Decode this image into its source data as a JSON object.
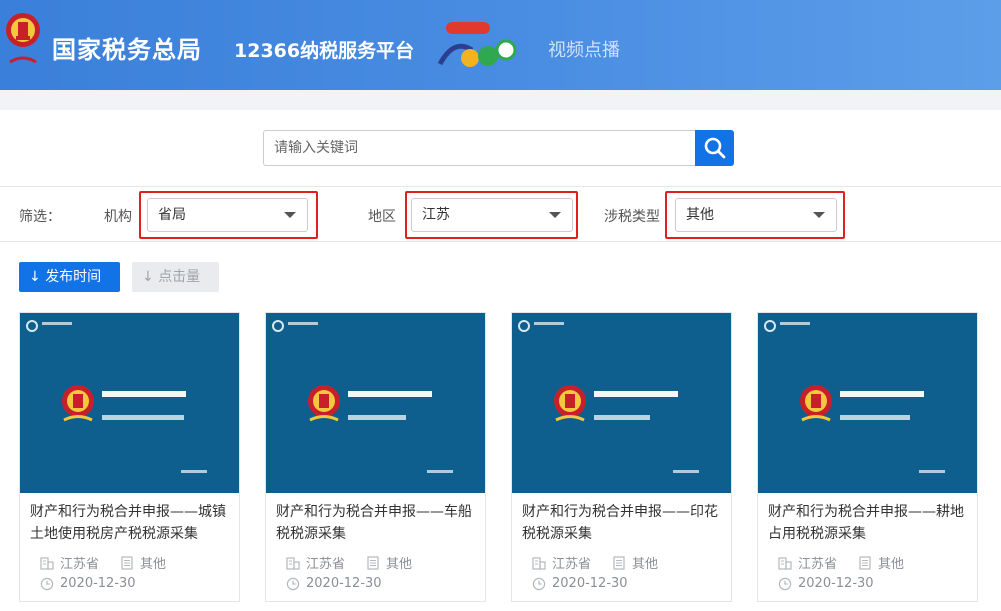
{
  "header": {
    "brand_title": "国家税务总局",
    "platform_title": "12366纳税服务平台",
    "nav_video": "视频点播"
  },
  "search": {
    "placeholder": "请输入关键词"
  },
  "filters": {
    "label": "筛选：",
    "org_label": "机构",
    "org_value": "省局",
    "region_label": "地区",
    "region_value": "江苏",
    "taxtype_label": "涉税类型",
    "taxtype_value": "其他"
  },
  "sort": {
    "publish_time": "发布时间",
    "clicks": "点击量"
  },
  "cards": [
    {
      "title": "财产和行为税合并申报——城镇土地使用税房产税税源采集",
      "region": "江苏省",
      "type": "其他",
      "date": "2020-12-30"
    },
    {
      "title": "财产和行为税合并申报——车船税税源采集",
      "region": "江苏省",
      "type": "其他",
      "date": "2020-12-30"
    },
    {
      "title": "财产和行为税合并申报——印花税税源采集",
      "region": "江苏省",
      "type": "其他",
      "date": "2020-12-30"
    },
    {
      "title": "财产和行为税合并申报——耕地占用税税源采集",
      "region": "江苏省",
      "type": "其他",
      "date": "2020-12-30"
    }
  ],
  "colors": {
    "header_blue": "#3a7fd9",
    "accent_blue": "#1273e6",
    "thumb_blue": "#0e5f8e",
    "highlight_red": "#e02020"
  }
}
